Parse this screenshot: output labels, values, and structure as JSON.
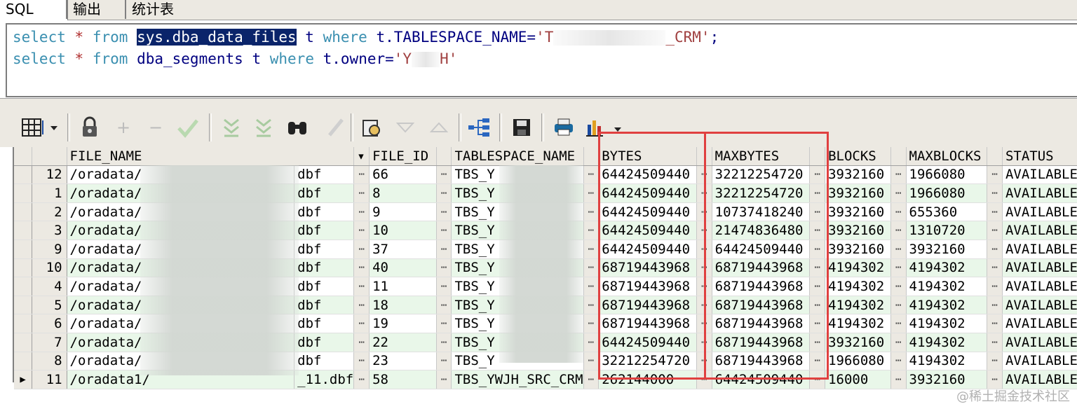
{
  "tabs": [
    {
      "label": "SQL"
    },
    {
      "label": "输出"
    },
    {
      "label": "统计表"
    }
  ],
  "editor": {
    "line1": {
      "kw1": "select",
      "star": "*",
      "kw2": "from",
      "table": "sys.dba_data_files",
      "alias": "t",
      "kw3": "where",
      "cond": "t.TABLESPACE_NAME=",
      "s1": "'T",
      "s2": "_CRM'",
      "end": ";"
    },
    "line2": {
      "kw1": "select",
      "star": "*",
      "kw2": "from",
      "table": "dba_segments",
      "alias": "t",
      "kw3": "where",
      "cond": "t.owner=",
      "s1": "'Y",
      "s2": "H'"
    }
  },
  "toolbar": {
    "icons": [
      "grid-layout-icon",
      "lock-icon",
      "add-icon",
      "remove-icon",
      "check-icon",
      "filter-down-icon",
      "filter-all-icon",
      "binoculars-icon",
      "clear-icon",
      "query-icon",
      "arrow-down-icon",
      "arrow-up-icon",
      "tree-icon",
      "save-icon",
      "print-icon",
      "chart-icon"
    ]
  },
  "grid": {
    "columns": [
      "FILE_NAME",
      "FILE_ID",
      "TABLESPACE_NAME",
      "BYTES",
      "MAXBYTES",
      "BLOCKS",
      "MAXBLOCKS",
      "STATUS"
    ],
    "rows": [
      {
        "n": "12",
        "file_prefix": "/oradata/",
        "file_suffix": "dbf",
        "file_id": "66",
        "ts": "TBS_Y",
        "bytes": "64424509440",
        "maxbytes": "32212254720",
        "blocks": "3932160",
        "maxblocks": "1966080",
        "status": "AVAILABLE"
      },
      {
        "n": "1",
        "file_prefix": "/oradata/",
        "file_suffix": "dbf",
        "file_id": "8",
        "ts": "TBS_Y",
        "bytes": "64424509440",
        "maxbytes": "32212254720",
        "blocks": "3932160",
        "maxblocks": "1966080",
        "status": "AVAILABLE"
      },
      {
        "n": "2",
        "file_prefix": "/oradata/",
        "file_suffix": "dbf",
        "file_id": "9",
        "ts": "TBS_Y",
        "bytes": "64424509440",
        "maxbytes": "10737418240",
        "blocks": "3932160",
        "maxblocks": "655360",
        "status": "AVAILABLE"
      },
      {
        "n": "3",
        "file_prefix": "/oradata/",
        "file_suffix": "dbf",
        "file_id": "10",
        "ts": "TBS_Y",
        "bytes": "64424509440",
        "maxbytes": "21474836480",
        "blocks": "3932160",
        "maxblocks": "1310720",
        "status": "AVAILABLE"
      },
      {
        "n": "9",
        "file_prefix": "/oradata/",
        "file_suffix": "dbf",
        "file_id": "37",
        "ts": "TBS_Y",
        "bytes": "64424509440",
        "maxbytes": "64424509440",
        "blocks": "3932160",
        "maxblocks": "3932160",
        "status": "AVAILABLE"
      },
      {
        "n": "10",
        "file_prefix": "/oradata/",
        "file_suffix": "dbf",
        "file_id": "40",
        "ts": "TBS_Y",
        "bytes": "68719443968",
        "maxbytes": "68719443968",
        "blocks": "4194302",
        "maxblocks": "4194302",
        "status": "AVAILABLE"
      },
      {
        "n": "4",
        "file_prefix": "/oradata/",
        "file_suffix": "dbf",
        "file_id": "11",
        "ts": "TBS_Y",
        "bytes": "68719443968",
        "maxbytes": "68719443968",
        "blocks": "4194302",
        "maxblocks": "4194302",
        "status": "AVAILABLE"
      },
      {
        "n": "5",
        "file_prefix": "/oradata/",
        "file_suffix": "dbf",
        "file_id": "18",
        "ts": "TBS_Y",
        "bytes": "68719443968",
        "maxbytes": "68719443968",
        "blocks": "4194302",
        "maxblocks": "4194302",
        "status": "AVAILABLE"
      },
      {
        "n": "6",
        "file_prefix": "/oradata/",
        "file_suffix": "dbf",
        "file_id": "19",
        "ts": "TBS_Y",
        "bytes": "68719443968",
        "maxbytes": "68719443968",
        "blocks": "4194302",
        "maxblocks": "4194302",
        "status": "AVAILABLE"
      },
      {
        "n": "7",
        "file_prefix": "/oradata/",
        "file_suffix": "dbf",
        "file_id": "22",
        "ts": "TBS_Y",
        "bytes": "64424509440",
        "maxbytes": "68719443968",
        "blocks": "3932160",
        "maxblocks": "4194302",
        "status": "AVAILABLE"
      },
      {
        "n": "8",
        "file_prefix": "/oradata/",
        "file_suffix": "dbf",
        "file_id": "23",
        "ts": "TBS_Y",
        "bytes": "32212254720",
        "maxbytes": "68719443968",
        "blocks": "1966080",
        "maxblocks": "4194302",
        "status": "AVAILABLE"
      },
      {
        "n": "11",
        "file_prefix": "/oradata1/",
        "file_suffix": "_11.dbf",
        "file_id": "58",
        "ts": "TBS_YWJH_SRC_CRM",
        "bytes": "262144000",
        "maxbytes": "64424509440",
        "blocks": "16000",
        "maxblocks": "3932160",
        "status": "AVAILABLE"
      }
    ]
  },
  "watermark": "@稀土掘金技术社区",
  "colors": {
    "accent_highlight": "#0a246a",
    "annotation_box": "#e04040",
    "alt_row": "#e9f7e9"
  }
}
